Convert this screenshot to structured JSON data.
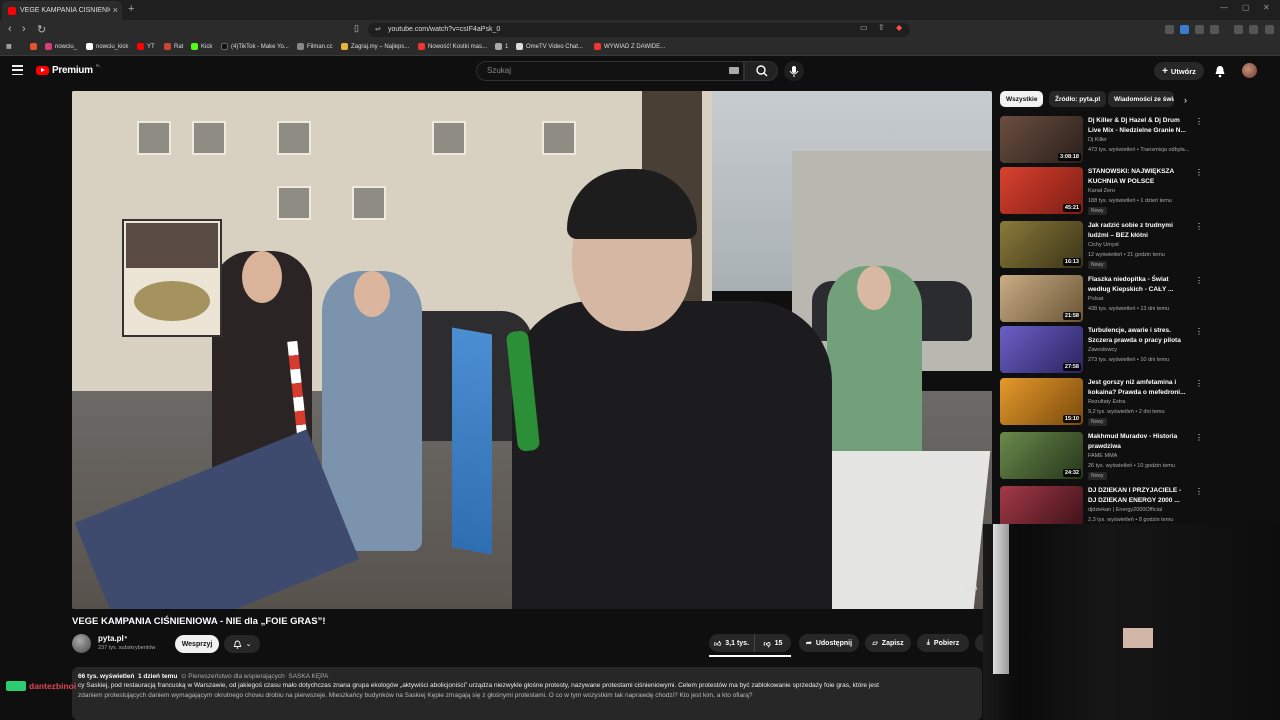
{
  "browser": {
    "tab_title": "VEGE KAMPANIA CIŚNIENIOWA",
    "url": "youtube.com/watch?v=csIF4aPsk_0",
    "bookmarks": [
      "nowciu_",
      "nowciu_kick",
      "YT",
      "Rat",
      "Kick",
      "(4)TikTok - Make Yo...",
      "Filman.cc",
      "Zagraj.my – Najleps...",
      "Nowość! Kostki mas...",
      "1",
      "OmeTV Video Chat...",
      "WYWIAD Z DAWIDE..."
    ]
  },
  "header": {
    "logo": "Premium",
    "logo_region": "PL",
    "search_placeholder": "Szukaj",
    "create_label": "Utwórz"
  },
  "video": {
    "title": "VEGE KAMPANIA CIŚNIENIOWA - NIE dla „FOIE GRAS”!",
    "watermark": "pyta",
    "channel": "pyta.pl",
    "subscribers": "237 tys. subskrybentów",
    "support_label": "Wesprzyj",
    "likes": "3,1 tys.",
    "dislikes": "15",
    "share_label": "Udostępnij",
    "save_label": "Zapisz",
    "download_label": "Pobierz"
  },
  "description": {
    "views": "66 tys. wyświetleń",
    "age": "1 dzień temu",
    "priority": "Pierwszeństwo dla wspierających",
    "location": "SASKA KĘPA",
    "line1": "cy Saskiej, pod restauracją francuską w Warszawie, od jakiegoś czasu mało dotychczas znana grupa ekologów „aktywiści abolicjoniści” urządza niezwykle głośne protesty, nazywane protestami ciśnieniowymi. Celem protestów ma być zablokowanie sprzedaży foie gras, które jest",
    "line2": "zdaniem protestujących daniem wymagającym okrutnego chowu drobiu na pierwszeje. Mieszkańcy budynków na Saskiej Kępie zmagają się z głośnymi protestami. O co w tym wszystkim tak naprawdę chodzi? Kto jest kim, a kto ofiarą?"
  },
  "overlay": {
    "streamer": "dantezbinoi"
  },
  "chips": [
    "Wszystkie",
    "Źródło: pyta.pl",
    "Wiadomości ze świata"
  ],
  "recommendations": [
    {
      "title": "Dj Killer & Dj Hazel & Dj Drum Live Mix - Niedzielne Granie N...",
      "channel": "Dj Killer",
      "meta": "473 tys. wyświetleń • Transmisja odbyła...",
      "duration": "3:08:18",
      "badge": "",
      "color": "#6b4f3f"
    },
    {
      "title": "STANOWSKI: NAJWIĘKSZA KUCHNIA W POLSCE",
      "channel": "Kanał Zero",
      "meta": "188 tys. wyświetleń • 1 dzień temu",
      "duration": "45:21",
      "badge": "Nowy",
      "color": "#b83a2e"
    },
    {
      "title": "Jak radzić sobie z trudnymi ludźmi – BEZ kłótni",
      "channel": "Cichy Umysł",
      "meta": "12 wyświetleń • 21 godzin temu",
      "duration": "16:13",
      "badge": "Nowy",
      "color": "#7a6a3a"
    },
    {
      "title": "Flaszka niedopitka - Świat według Kiepskich - CAŁY ...",
      "channel": "Polsat",
      "meta": "438 tys. wyświetleń • 13 dni temu",
      "duration": "21:58",
      "badge": "",
      "color": "#a88f6a"
    },
    {
      "title": "Turbulencje, awarie i stres. Szczera prawda o pracy pilota ...",
      "channel": "Zawodowcy",
      "meta": "273 tys. wyświetleń • 10 dni temu",
      "duration": "27:58",
      "badge": "",
      "color": "#5b4fa3"
    },
    {
      "title": "Jest gorszy niż amfetamina i kokaina? Prawda o mefedroni...",
      "channel": "Rezultaty Extra",
      "meta": "9,2 tys. wyświetleń • 2 dni temu",
      "duration": "15:10",
      "badge": "Nowy",
      "color": "#c9801f"
    },
    {
      "title": "Makhmud Muradov - Historia prawdziwa",
      "channel": "FAME MMA",
      "meta": "26 tys. wyświetleń • 10 godzin temu",
      "duration": "24:32",
      "badge": "Nowy",
      "color": "#4d6a3c"
    },
    {
      "title": "DJ DZIEKAN I PRZYJACIELE - DJ DZIEKAN ENERGY 2000 ...",
      "channel": "djdziekan | Energy2000Official",
      "meta": "2,3 tys. wyświetleń • 8 godzin temu",
      "duration": "",
      "badge": "",
      "color": "#8a2f3a"
    }
  ]
}
